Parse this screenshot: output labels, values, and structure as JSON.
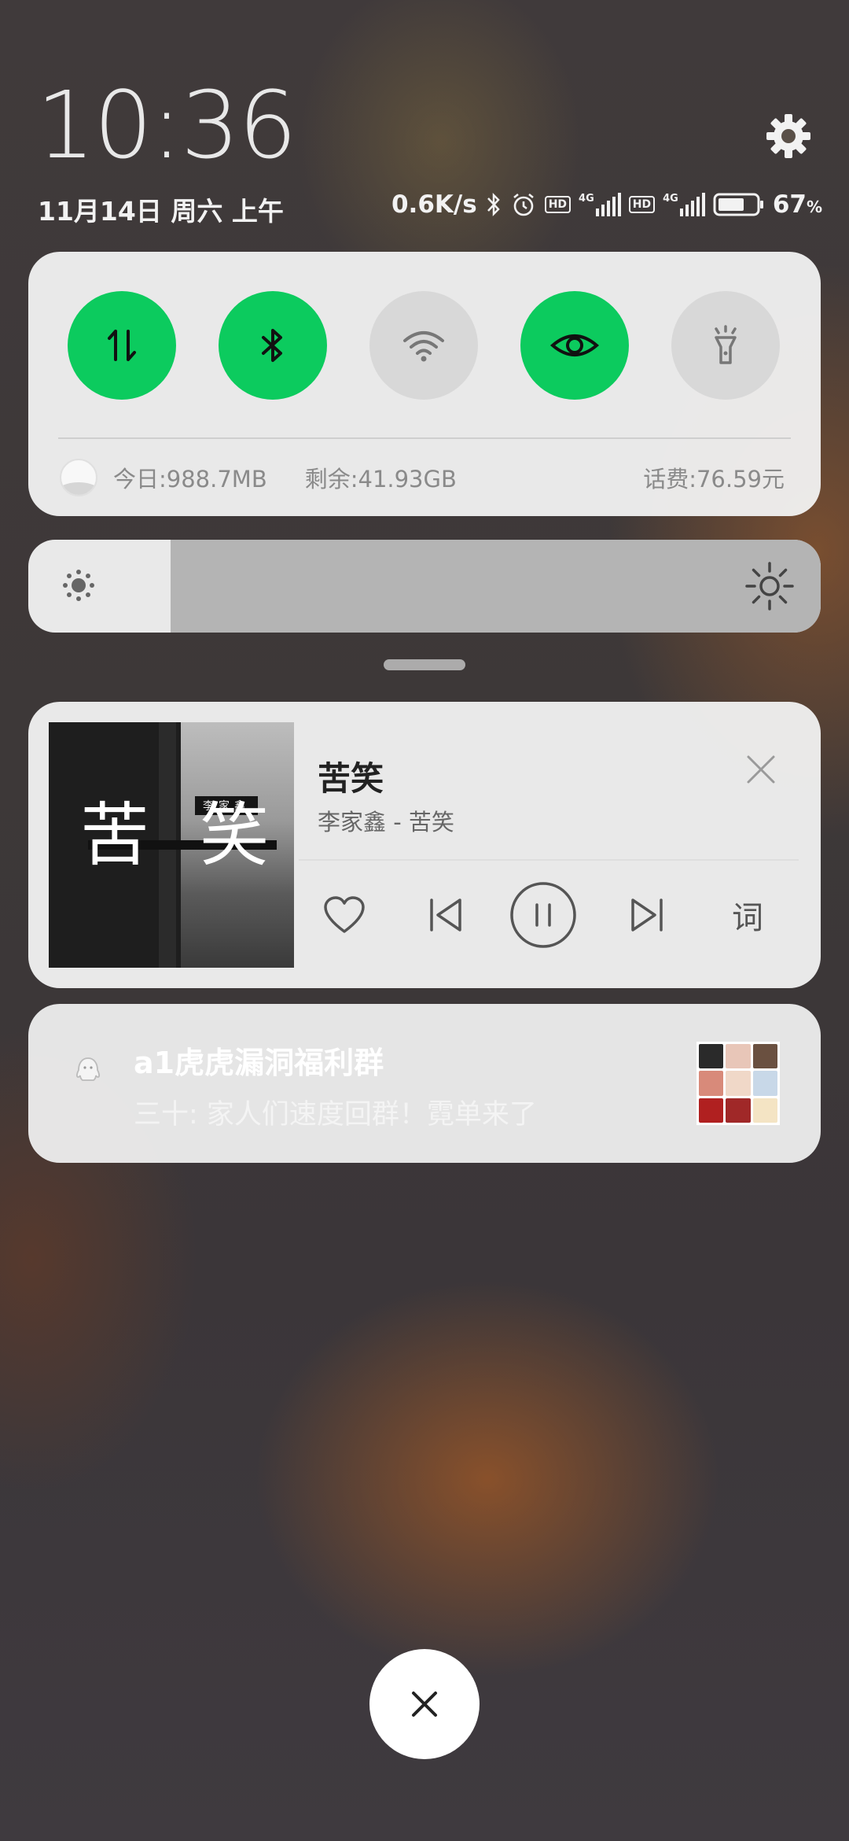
{
  "header": {
    "time": "10:36",
    "date": "11月14日 周六 上午",
    "net_speed": "0.6K/s",
    "battery_pct": "67",
    "battery_unit": "%",
    "hd1": "HD",
    "net1": "4G",
    "hd2": "HD",
    "net2": "4G"
  },
  "quick_settings": {
    "toggles": [
      {
        "name": "mobile-data",
        "state": "on"
      },
      {
        "name": "bluetooth",
        "state": "on"
      },
      {
        "name": "wifi",
        "state": "off"
      },
      {
        "name": "eye-comfort",
        "state": "on"
      },
      {
        "name": "flashlight",
        "state": "off"
      }
    ],
    "data_today": "今日:988.7MB",
    "data_remaining": "剩余:41.93GB",
    "phone_balance": "话费:76.59元"
  },
  "brightness": {
    "level": 0.18
  },
  "music": {
    "title": "苦笑",
    "artist_album": "李家鑫 - 苦笑",
    "album_text_1": "苦",
    "album_text_2": "笑",
    "album_tag": "李家鑫",
    "lyrics_label": "词"
  },
  "notification": {
    "title": "a1虎虎漏洞福利群",
    "body": "三十: 家人们速度回群！霓单来了"
  },
  "colors": {
    "accent_on": "#0ccb5e",
    "toggle_off": "#d8d8d8"
  }
}
